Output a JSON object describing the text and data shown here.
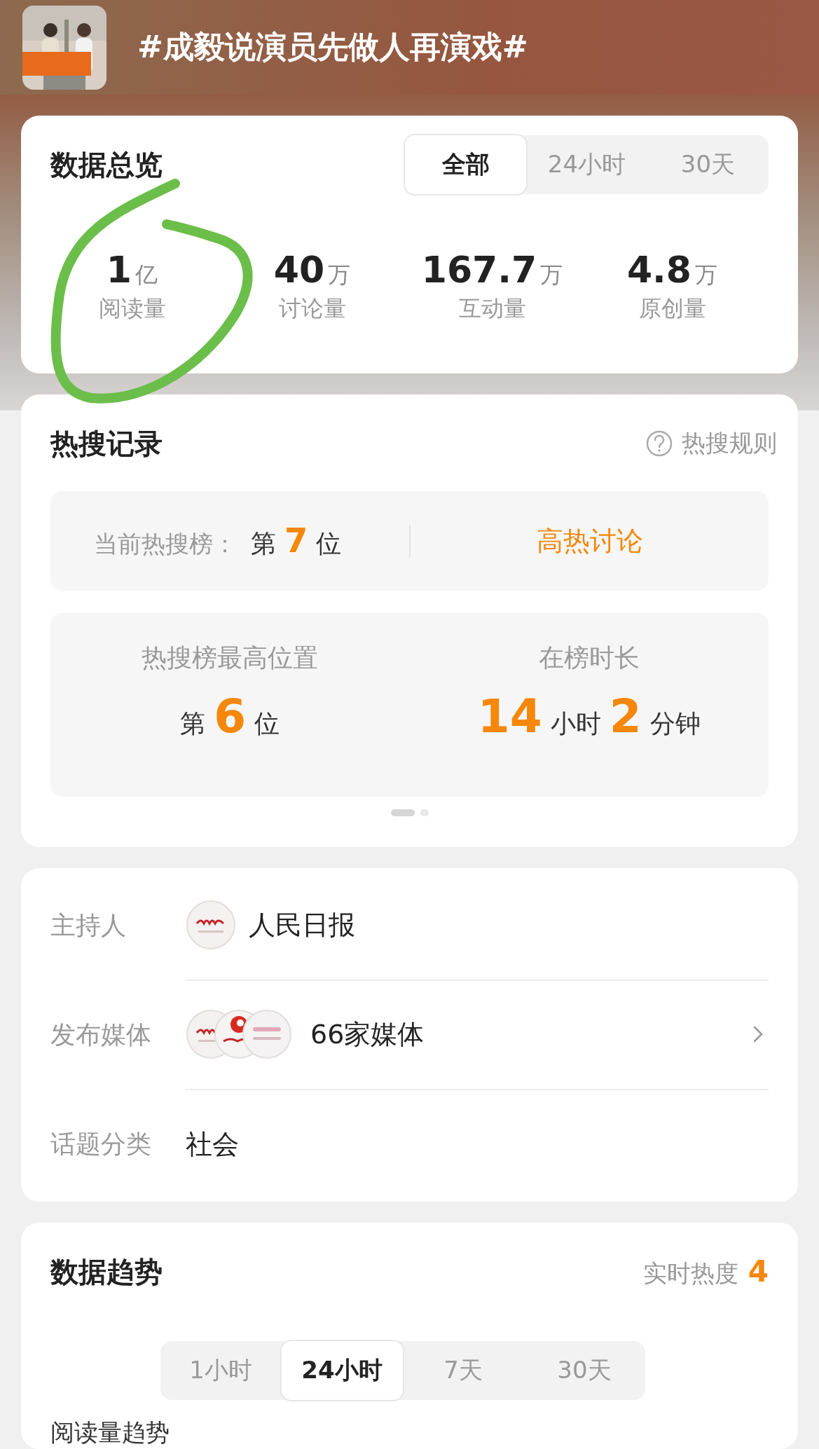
{
  "header": {
    "title": "#成毅说演员先做人再演戏#"
  },
  "overview": {
    "title": "数据总览",
    "tabs": [
      {
        "label": "全部",
        "selected": true
      },
      {
        "label": "24小时",
        "selected": false
      },
      {
        "label": "30天",
        "selected": false
      }
    ],
    "stats": [
      {
        "value": "1",
        "unit": "亿",
        "label": "阅读量"
      },
      {
        "value": "40",
        "unit": "万",
        "label": "讨论量"
      },
      {
        "value": "167.7",
        "unit": "万",
        "label": "互动量"
      },
      {
        "value": "4.8",
        "unit": "万",
        "label": "原创量"
      }
    ]
  },
  "hot_search": {
    "title": "热搜记录",
    "rules_link": "热搜规则",
    "current": {
      "label": "当前热搜榜：",
      "prefix": "第",
      "rank": "7",
      "suffix": "位",
      "tag": "高热讨论"
    },
    "best": {
      "label": "热搜榜最高位置",
      "prefix": "第",
      "rank": "6",
      "suffix": "位"
    },
    "duration": {
      "label": "在榜时长",
      "hours": "14",
      "hours_unit": "小时",
      "minutes": "2",
      "minutes_unit": "分钟"
    },
    "pager": [
      {
        "selected": true
      },
      {
        "selected": false
      }
    ]
  },
  "info": {
    "rows": [
      {
        "kind": "host",
        "label": "主持人",
        "value": "人民日报"
      },
      {
        "kind": "media",
        "label": "发布媒体",
        "value": "66家媒体"
      },
      {
        "kind": "category",
        "label": "话题分类",
        "value": "社会"
      }
    ]
  },
  "trend": {
    "title": "数据趋势",
    "heat_label": "实时热度",
    "heat_value": "4",
    "tabs": [
      {
        "label": "1小时",
        "selected": false
      },
      {
        "label": "24小时",
        "selected": true
      },
      {
        "label": "7天",
        "selected": false
      },
      {
        "label": "30天",
        "selected": false
      }
    ],
    "subtitle": "阅读量趋势"
  }
}
